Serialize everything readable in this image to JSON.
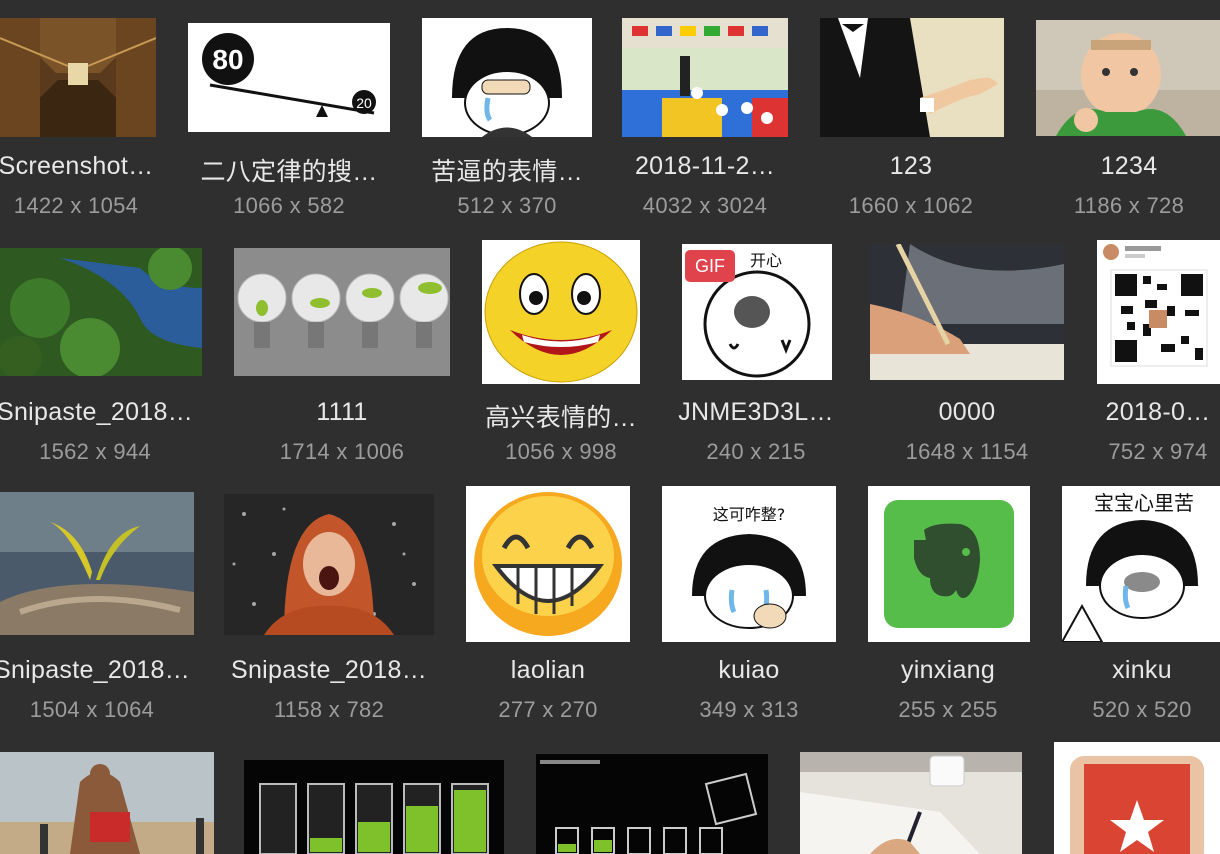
{
  "gallery": {
    "items": [
      {
        "name": "Screenshot…",
        "dims": "1422 x 1054",
        "icon": "library-corridor-photo"
      },
      {
        "name": "二八定律的搜…",
        "dims": "1066 x 582",
        "icon": "seesaw-80-20-diagram"
      },
      {
        "name": "苦逼的表情…",
        "dims": "512 x 370",
        "icon": "crying-meme-face"
      },
      {
        "name": "2018-11-2…",
        "dims": "4032 x 3024",
        "icon": "classroom-photo"
      },
      {
        "name": "123",
        "dims": "1660 x 1062",
        "icon": "tuxedo-man-photo"
      },
      {
        "name": "1234",
        "dims": "1186 x 728",
        "icon": "success-baby-photo"
      },
      {
        "name": "Snipaste_2018…",
        "dims": "1562 x 944",
        "icon": "river-forest-photo"
      },
      {
        "name": "1111",
        "dims": "1714 x 1006",
        "icon": "lightbulbs-sprouts-photo"
      },
      {
        "name": "高兴表情的…",
        "dims": "1056 x 998",
        "icon": "happy-smiley-face"
      },
      {
        "name": "JNME3D3L…",
        "dims": "240 x 215",
        "icon": "meme-bear-gif",
        "gif": "GIF",
        "caption": "开心"
      },
      {
        "name": "0000",
        "dims": "1648 x 1154",
        "icon": "writing-hand-photo"
      },
      {
        "name": "2018-0…",
        "dims": "752 x 974",
        "icon": "qr-code-screenshot"
      },
      {
        "name": "Snipaste_2018…",
        "dims": "1504 x 1064",
        "icon": "plant-on-rock-photo"
      },
      {
        "name": "Snipaste_2018…",
        "dims": "1158 x 782",
        "icon": "woman-in-rain-photo"
      },
      {
        "name": "laolian",
        "dims": "277 x 270",
        "icon": "grinning-smiley-face"
      },
      {
        "name": "kuiao",
        "dims": "349 x 313",
        "icon": "crying-meme-face",
        "caption": "这可咋整?"
      },
      {
        "name": "yinxiang",
        "dims": "255 x 255",
        "icon": "evernote-logo"
      },
      {
        "name": "xinku",
        "dims": "520 x 520",
        "icon": "crying-meme-face",
        "caption": "宝宝心里苦"
      },
      {
        "name": "",
        "dims": "",
        "icon": "wrestlers-photo"
      },
      {
        "name": "",
        "dims": "",
        "icon": "batteries-photo"
      },
      {
        "name": "",
        "dims": "",
        "icon": "battery-meme"
      },
      {
        "name": "",
        "dims": "",
        "icon": "desk-writing-photo"
      },
      {
        "name": "",
        "dims": "",
        "icon": "wunderlist-logo"
      }
    ]
  },
  "colors": {
    "background": "#2f2f2f",
    "name_text": "#e8e8e8",
    "dims_text": "#9c9c9c",
    "gif_badge": "#e0434b"
  }
}
